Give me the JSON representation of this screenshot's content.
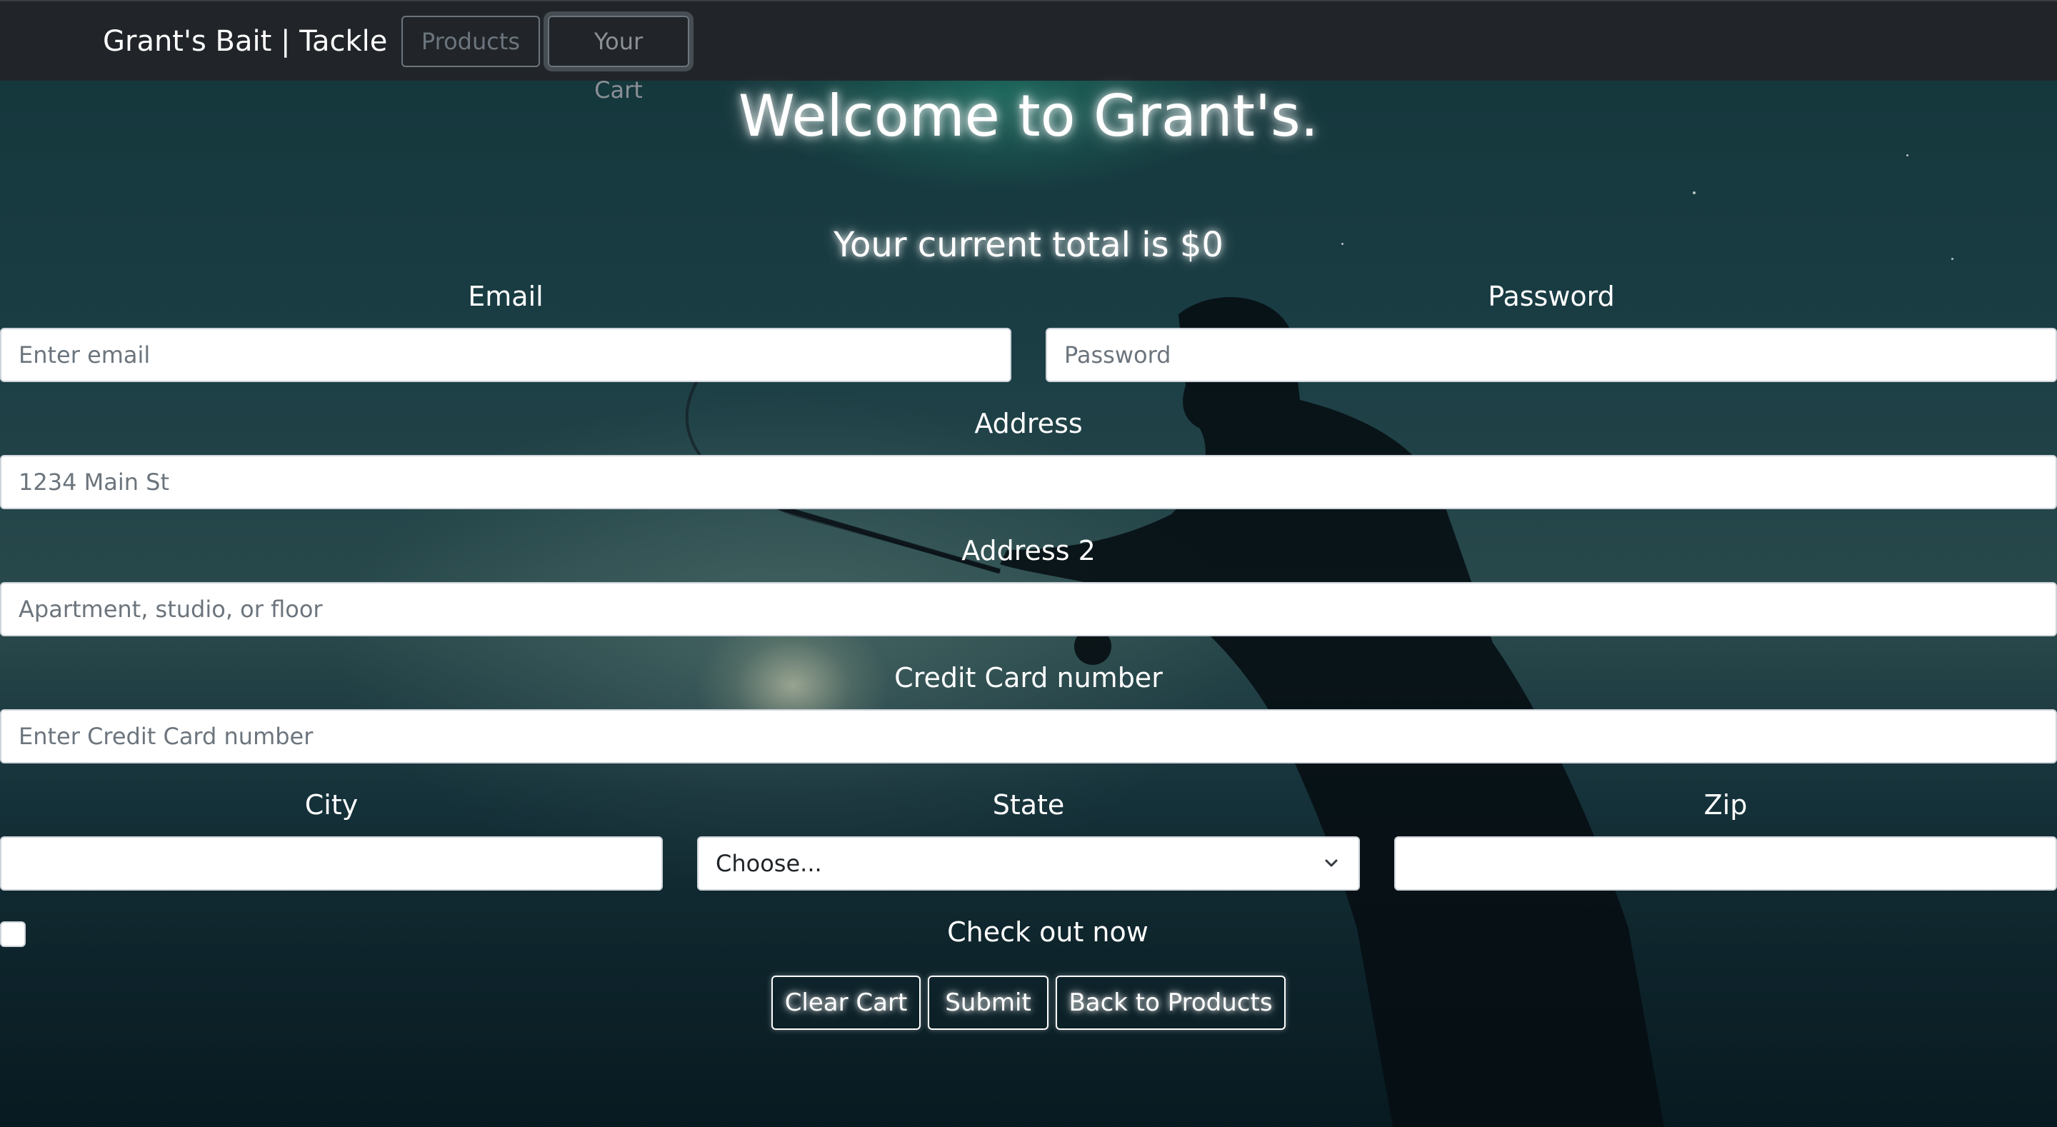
{
  "navbar": {
    "brand": "Grant's Bait | Tackle",
    "products_label": "Products",
    "cart_label": "Your Cart"
  },
  "page": {
    "title": "Welcome to Grant's.",
    "total_text": "Your current total is $0"
  },
  "form": {
    "email": {
      "label": "Email",
      "placeholder": "Enter email",
      "value": ""
    },
    "password": {
      "label": "Password",
      "placeholder": "Password",
      "value": ""
    },
    "address": {
      "label": "Address",
      "placeholder": "1234 Main St",
      "value": ""
    },
    "address2": {
      "label": "Address 2",
      "placeholder": "Apartment, studio, or floor",
      "value": ""
    },
    "credit_card": {
      "label": "Credit Card number",
      "placeholder": "Enter Credit Card number",
      "value": ""
    },
    "city": {
      "label": "City",
      "value": ""
    },
    "state": {
      "label": "State",
      "selected": "Choose..."
    },
    "zip": {
      "label": "Zip",
      "value": ""
    },
    "checkout": {
      "label": "Check out now",
      "checked": false
    }
  },
  "actions": {
    "clear_cart": "Clear Cart",
    "submit": "Submit",
    "back_to_products": "Back to Products"
  },
  "colors": {
    "navbar_bg": "#212529",
    "text": "#ffffff",
    "nav_button": "#6c757d"
  }
}
